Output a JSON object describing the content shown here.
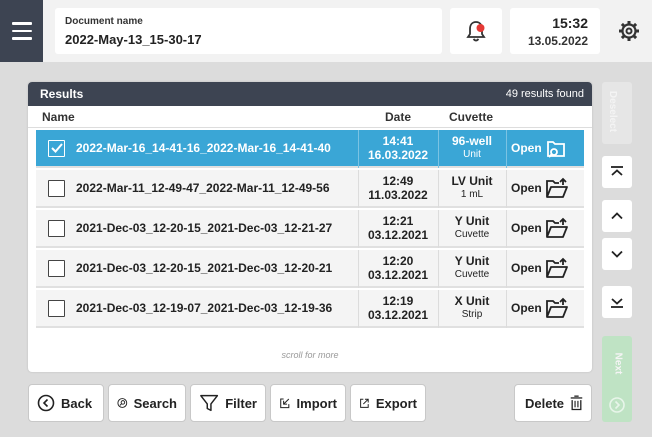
{
  "header": {
    "doc_label": "Document name",
    "doc_name": "2022-May-13_15-30-17",
    "time": "15:32",
    "date": "13.05.2022"
  },
  "results": {
    "title": "Results",
    "count": "49 results found",
    "columns": {
      "name": "Name",
      "date": "Date",
      "cuvette": "Cuvette"
    },
    "rows": [
      {
        "name": "2022-Mar-16_14-41-16_2022-Mar-16_14-41-40",
        "time": "14:41",
        "date": "16.03.2022",
        "cuvette": "96-well",
        "cuvette_sub": "Unit",
        "open": "Open",
        "selected": true
      },
      {
        "name": "2022-Mar-11_12-49-47_2022-Mar-11_12-49-56",
        "time": "12:49",
        "date": "11.03.2022",
        "cuvette": "LV Unit",
        "cuvette_sub": "1 mL",
        "open": "Open",
        "selected": false
      },
      {
        "name": "2021-Dec-03_12-20-15_2021-Dec-03_12-21-27",
        "time": "12:21",
        "date": "03.12.2021",
        "cuvette": "Y Unit",
        "cuvette_sub": "Cuvette",
        "open": "Open",
        "selected": false
      },
      {
        "name": "2021-Dec-03_12-20-15_2021-Dec-03_12-20-21",
        "time": "12:20",
        "date": "03.12.2021",
        "cuvette": "Y Unit",
        "cuvette_sub": "Cuvette",
        "open": "Open",
        "selected": false
      },
      {
        "name": "2021-Dec-03_12-19-07_2021-Dec-03_12-19-36",
        "time": "12:19",
        "date": "03.12.2021",
        "cuvette": "X Unit",
        "cuvette_sub": "Strip",
        "open": "Open",
        "selected": false
      }
    ],
    "scroll_hint": "scroll for more"
  },
  "side": {
    "deselect_label": "Deselect",
    "next_label": "Next"
  },
  "toolbar": {
    "back": "Back",
    "search": "Search",
    "filter": "Filter",
    "import": "Import",
    "export": "Export",
    "delete": "Delete"
  },
  "colors": {
    "accent": "#3aa6d6",
    "dark": "#3d4452",
    "alert": "#e53935"
  }
}
